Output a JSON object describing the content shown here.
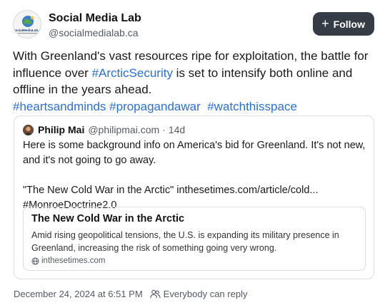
{
  "author": {
    "name": "Social Media Lab",
    "handle": "@socialmedialab.ca",
    "avatar_logo_text": "SocialMediaLab.ca"
  },
  "follow_button": {
    "icon": "plus-icon",
    "label": "Follow"
  },
  "post": {
    "text_1": "With Greenland's vast resources ripe for exploitation, the battle for influence over ",
    "tag_1": "#ArcticSecurity",
    "text_2": " is set to intensify both online and offline in the years ahead.",
    "tag_2": "#heartsandminds",
    "tag_3": "#propagandawar",
    "tag_4": "#watchthisspace"
  },
  "quoted": {
    "author_name": "Philip Mai",
    "author_handle": "@philipmai.com",
    "separator": "·",
    "age": "14d",
    "line_1": "Here is some background info on America's bid for Greenland. It's not new, and it's not going to go away.",
    "line_2": "\"The New Cold War in the Arctic\" inthesetimes.com/article/cold...",
    "line_3": "#MonroeDoctrine2.0",
    "link_card": {
      "title": "The New Cold War in the Arctic",
      "description": "Amid rising geopolitical tensions, the U.S. is expanding its military presence in Greenland, increasing the risk of something going very wrong.",
      "domain": "inthesetimes.com"
    }
  },
  "footer": {
    "timestamp": "December 24, 2024 at 6:51 PM",
    "reply_icon": "people-icon",
    "reply_setting": "Everybody can reply"
  },
  "colors": {
    "accent": "#2a6fdb",
    "button_bg": "#353c46",
    "muted_text": "#555a66",
    "border": "#dcdde2"
  }
}
